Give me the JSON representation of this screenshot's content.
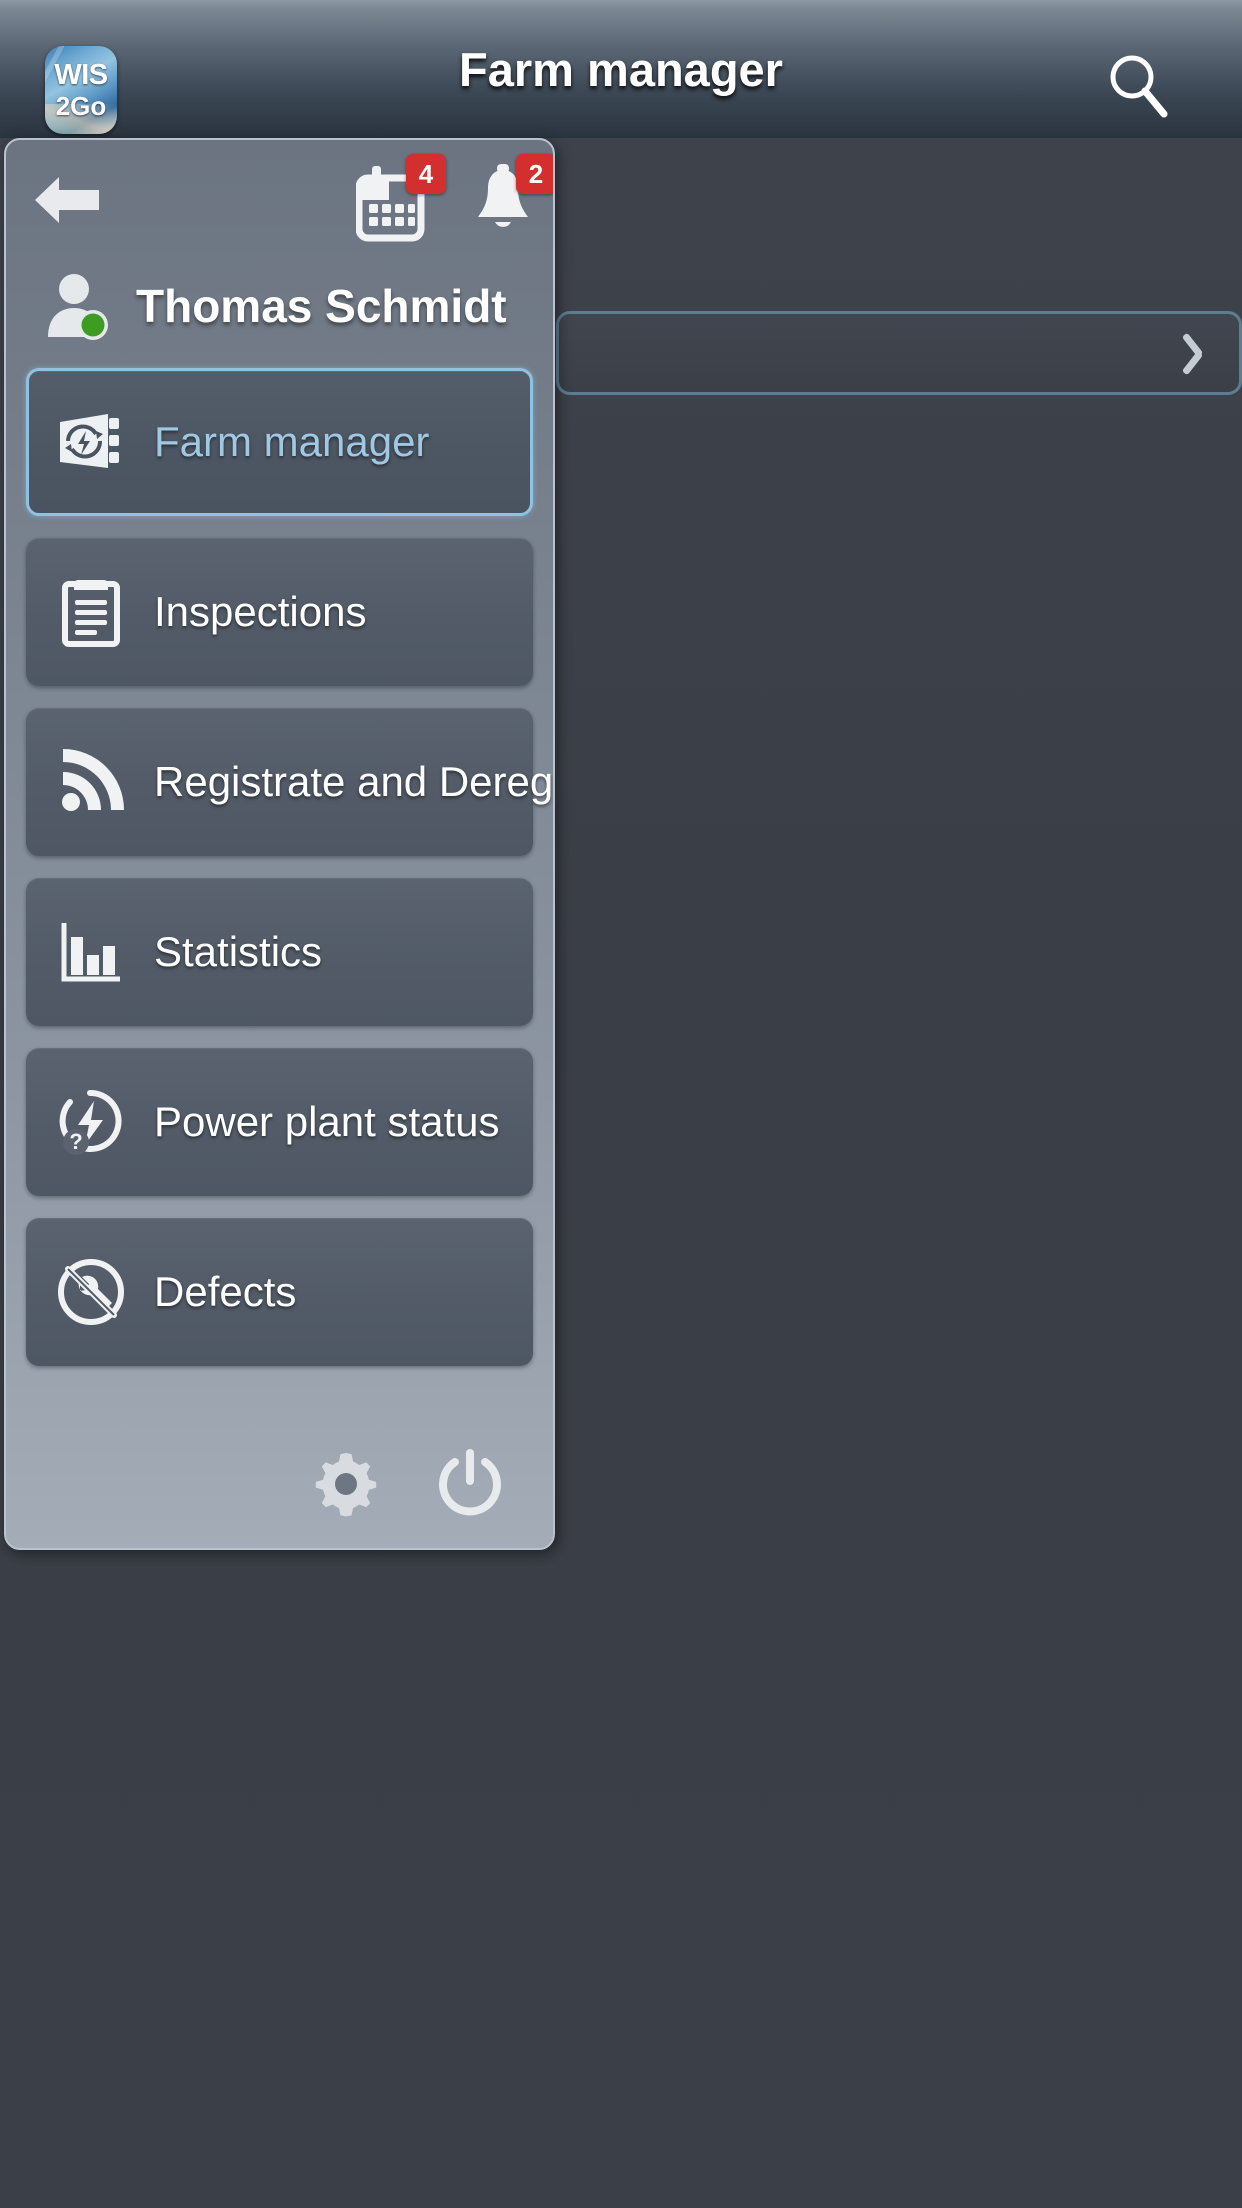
{
  "header": {
    "title": "Farm manager",
    "logo": {
      "line1": "WIS",
      "line2": "2Go"
    },
    "search_icon": "search-icon"
  },
  "drawer": {
    "back_icon": "back-arrow-icon",
    "calendar": {
      "icon": "calendar-icon",
      "badge": "4"
    },
    "notifications": {
      "icon": "bell-icon",
      "badge": "2"
    },
    "user": {
      "name": "Thomas Schmidt",
      "status": "online",
      "status_color": "#3f9c23"
    },
    "items": [
      {
        "label": "Farm manager",
        "icon": "farm-manager-icon",
        "selected": true
      },
      {
        "label": "Inspections",
        "icon": "clipboard-icon",
        "selected": false
      },
      {
        "label": "Registrate and Deregi...",
        "icon": "rss-signal-icon",
        "selected": false
      },
      {
        "label": "Statistics",
        "icon": "bar-chart-icon",
        "selected": false
      },
      {
        "label": "Power plant status",
        "icon": "power-plant-status-icon",
        "selected": false
      },
      {
        "label": "Defects",
        "icon": "wrench-defect-icon",
        "selected": false
      }
    ],
    "footer": {
      "settings_icon": "gear-icon",
      "power_icon": "power-icon"
    }
  },
  "content": {
    "row_chevron_icon": "chevron-right-icon"
  },
  "colors": {
    "accent": "#8fc2e0",
    "badge": "#d32f2f",
    "topbar_dark": "#2a343f",
    "drawer_item": "#525b67"
  }
}
